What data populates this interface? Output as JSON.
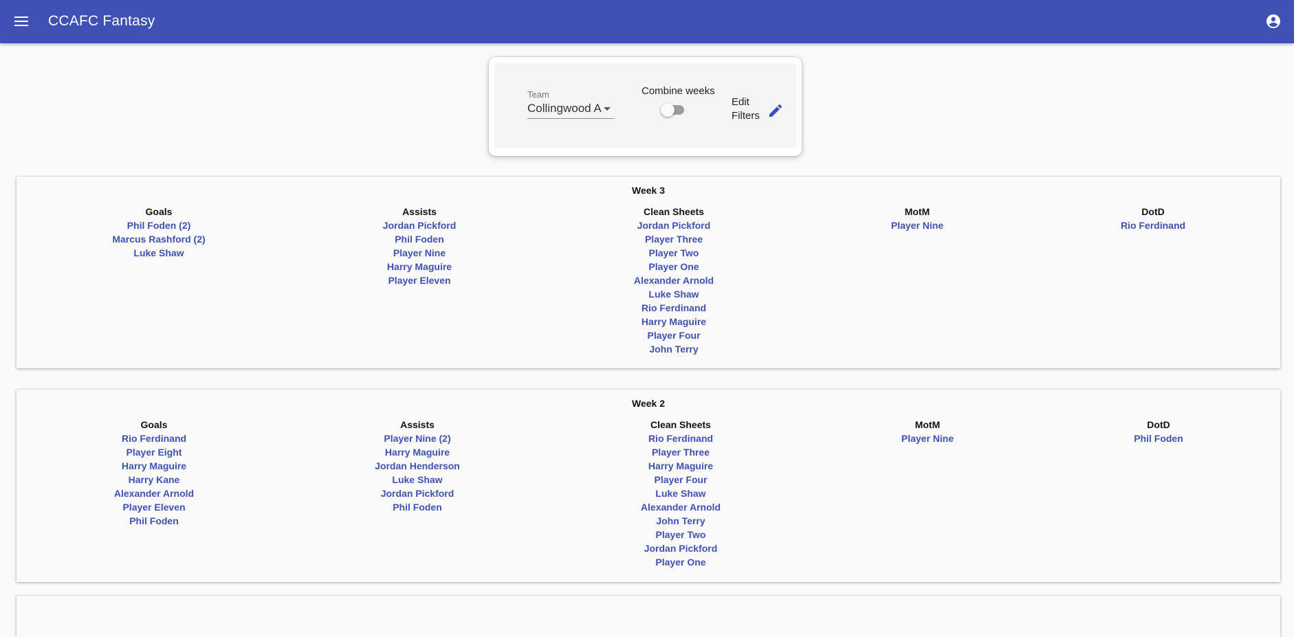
{
  "app": {
    "title": "CCAFC Fantasy"
  },
  "filters": {
    "team_label": "Team",
    "team_value": "Collingwood A",
    "combine_label": "Combine weeks",
    "combine_on": false,
    "edit_label": "Edit Filters"
  },
  "colors": {
    "primary": "#3f51b5",
    "background": "#fafafa"
  },
  "icons": {
    "menu": "menu-icon",
    "account": "account-circle-icon",
    "edit": "pencil-icon"
  },
  "weeks": [
    {
      "title": "Week 3",
      "goals": {
        "label": "Goals",
        "items": [
          "Phil Foden (2)",
          "Marcus Rashford (2)",
          "Luke Shaw"
        ]
      },
      "assists": {
        "label": "Assists",
        "items": [
          "Jordan Pickford",
          "Phil Foden",
          "Player Nine",
          "Harry Maguire",
          "Player Eleven"
        ]
      },
      "clean_sheets": {
        "label": "Clean Sheets",
        "items": [
          "Jordan Pickford",
          "Player Three",
          "Player Two",
          "Player One",
          "Alexander Arnold",
          "Luke Shaw",
          "Rio Ferdinand",
          "Harry Maguire",
          "Player Four",
          "John Terry"
        ]
      },
      "motm": {
        "label": "MotM",
        "items": [
          "Player Nine"
        ]
      },
      "dotd": {
        "label": "DotD",
        "items": [
          "Rio Ferdinand"
        ]
      }
    },
    {
      "title": "Week 2",
      "goals": {
        "label": "Goals",
        "items": [
          "Rio Ferdinand",
          "Player Eight",
          "Harry Maguire",
          "Harry Kane",
          "Alexander Arnold",
          "Player Eleven",
          "Phil Foden"
        ]
      },
      "assists": {
        "label": "Assists",
        "items": [
          "Player Nine (2)",
          "Harry Maguire",
          "Jordan Henderson",
          "Luke Shaw",
          "Jordan Pickford",
          "Phil Foden"
        ]
      },
      "clean_sheets": {
        "label": "Clean Sheets",
        "items": [
          "Rio Ferdinand",
          "Player Three",
          "Harry Maguire",
          "Player Four",
          "Luke Shaw",
          "Alexander Arnold",
          "John Terry",
          "Player Two",
          "Jordan Pickford",
          "Player One"
        ]
      },
      "motm": {
        "label": "MotM",
        "items": [
          "Player Nine"
        ]
      },
      "dotd": {
        "label": "DotD",
        "items": [
          "Phil Foden"
        ]
      }
    }
  ]
}
